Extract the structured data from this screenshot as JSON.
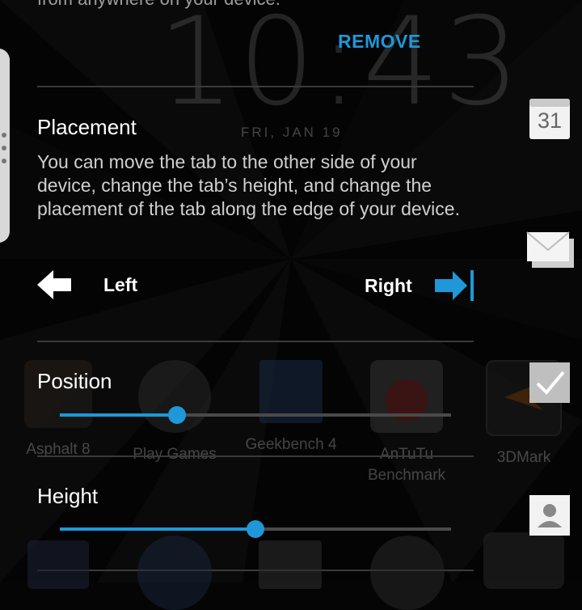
{
  "lockscreen": {
    "clock": "10:43",
    "date": "FRI, JAN 19"
  },
  "top_text_cut": "from anywhere on your device.",
  "remove_label": "REMOVE",
  "placement": {
    "title": "Placement",
    "description": "You can move the tab to the other side of your device, change the tab’s height, and change the placement of the tab along the edge of your device.",
    "left_label": "Left",
    "right_label": "Right",
    "selected": "Right"
  },
  "position": {
    "title": "Position",
    "value": 0.3
  },
  "height": {
    "title": "Height",
    "value": 0.5
  },
  "apps": [
    {
      "label": "Asphalt 8"
    },
    {
      "label": "Play Games"
    },
    {
      "label": "Geekbench 4"
    },
    {
      "label": "AnTuTu Benchmark"
    },
    {
      "label": "3DMark"
    }
  ],
  "calendar_day": "31",
  "colors": {
    "accent": "#1e98d8",
    "background": "#050505",
    "divider": "#3a3a3a"
  },
  "icons": [
    "arrow-left-icon",
    "arrow-right-bar-icon",
    "calendar-icon",
    "mail-icon",
    "checkbox-icon",
    "contact-icon"
  ]
}
